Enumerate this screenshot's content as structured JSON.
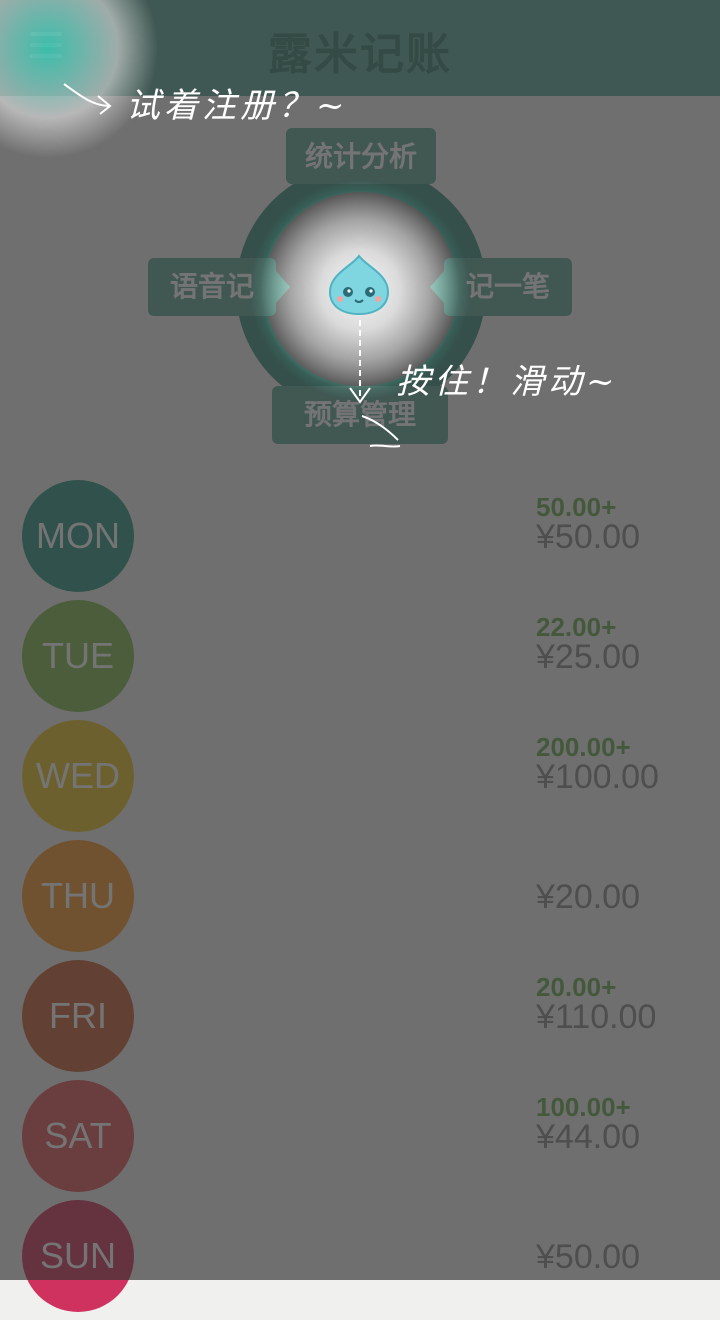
{
  "header": {
    "title": "露米记账"
  },
  "wheel": {
    "top": "统计分析",
    "left": "语音记",
    "right": "记一笔",
    "bottom": "预算管理"
  },
  "hints": {
    "register": "试着注册？~",
    "press": "按住！滑动~"
  },
  "days": [
    {
      "label": "MON",
      "color": "#2c9484",
      "income": "50.00+",
      "amount": "¥50.00"
    },
    {
      "label": "TUE",
      "color": "#7fb84b",
      "income": "22.00+",
      "amount": "¥25.00"
    },
    {
      "label": "WED",
      "color": "#e9c229",
      "income": "200.00+",
      "amount": "¥100.00"
    },
    {
      "label": "THU",
      "color": "#f2962d",
      "income": "",
      "amount": "¥20.00"
    },
    {
      "label": "FRI",
      "color": "#c8613a",
      "income": "20.00+",
      "amount": "¥110.00"
    },
    {
      "label": "SAT",
      "color": "#e0555a",
      "income": "100.00+",
      "amount": "¥44.00"
    },
    {
      "label": "SUN",
      "color": "#d0325f",
      "income": "",
      "amount": "¥50.00"
    }
  ]
}
